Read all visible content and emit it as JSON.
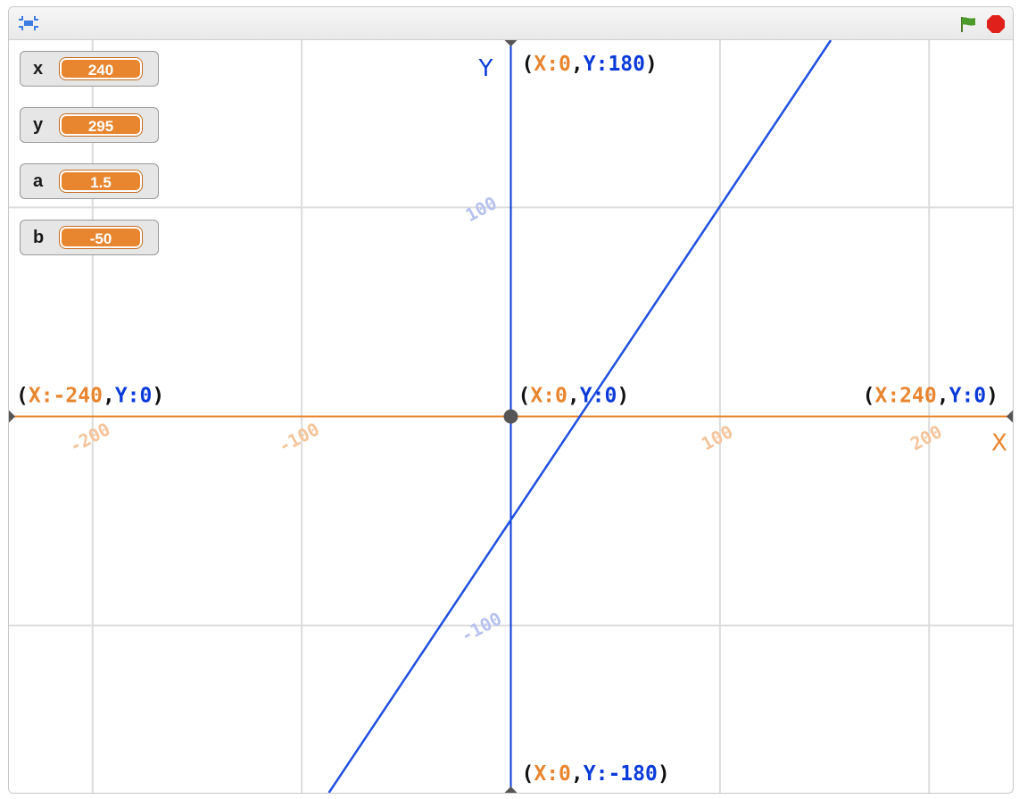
{
  "toolbar": {
    "fullscreen_icon": "fullscreen-icon",
    "green_flag_icon": "green-flag-icon",
    "stop_icon": "stop-icon"
  },
  "monitors": [
    {
      "name": "x",
      "value": "240"
    },
    {
      "name": "y",
      "value": "295"
    },
    {
      "name": "a",
      "value": "1.5"
    },
    {
      "name": "b",
      "value": "-50"
    }
  ],
  "axes": {
    "x_axis_label": "X",
    "y_axis_label": "Y",
    "x_ticks": [
      "-200",
      "-100",
      "100",
      "200"
    ],
    "y_ticks": [
      "100",
      "-100"
    ]
  },
  "coord_labels": {
    "top": {
      "x": "X:0",
      "y": "Y:180"
    },
    "origin": {
      "x": "X:0",
      "y": "Y:0"
    },
    "left": {
      "x": "X:-240",
      "y": "Y:0"
    },
    "right": {
      "x": "X:240",
      "y": "Y:0"
    },
    "bottom": {
      "x": "X:0",
      "y": "Y:-180"
    }
  },
  "colors": {
    "x_color": "#e8852f",
    "y_color": "#0a3bd9",
    "line_color": "#1f4fe0",
    "grid_color": "#dcdcdc",
    "x_tick_color": "#f5c49a",
    "y_tick_color": "#b8c2f0"
  },
  "chart_data": {
    "type": "line",
    "title": "",
    "xlabel": "X",
    "ylabel": "Y",
    "xlim": [
      -240,
      240
    ],
    "ylim": [
      -180,
      180
    ],
    "grid": true,
    "x_gridlines": [
      -200,
      -100,
      0,
      100,
      200
    ],
    "y_gridlines": [
      -100,
      0,
      100
    ],
    "series": [
      {
        "x": [
          -87,
          153
        ],
        "y": [
          -180,
          180
        ]
      }
    ]
  }
}
